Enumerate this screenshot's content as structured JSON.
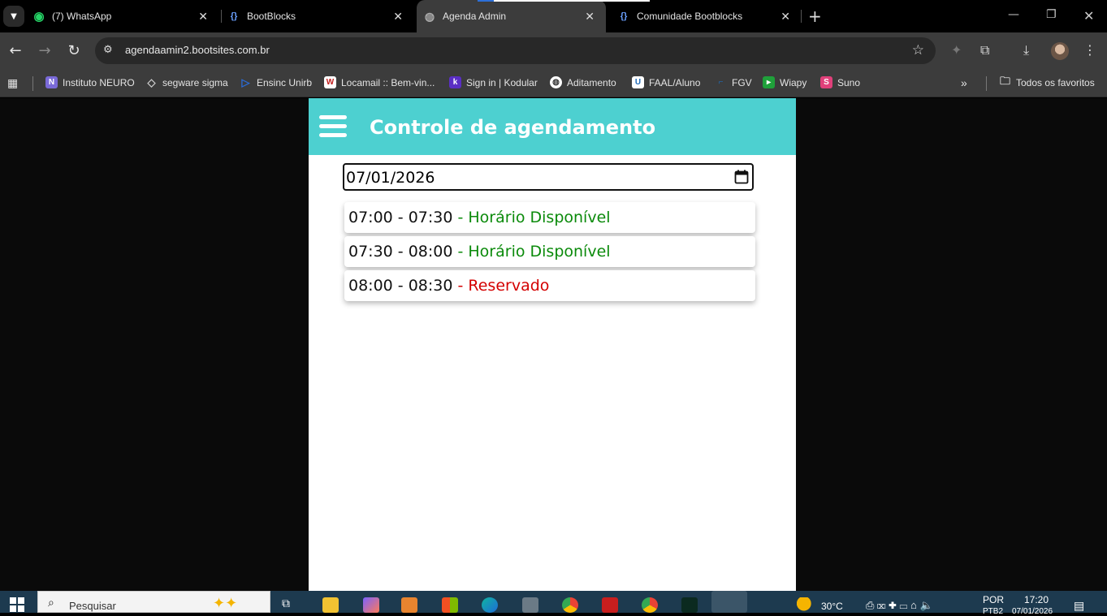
{
  "browser": {
    "tabs": [
      {
        "title": "(7) WhatsApp",
        "icon": "whatsapp-icon",
        "active": false
      },
      {
        "title": "BootBlocks",
        "icon": "bootblocks-icon",
        "active": false
      },
      {
        "title": "Agenda Admin",
        "icon": "globe-icon",
        "active": true
      },
      {
        "title": "Comunidade Bootblocks",
        "icon": "bootblocks-icon",
        "active": false
      }
    ],
    "url": "agendaamin2.bootsites.com.br",
    "bookmarks": [
      {
        "label": "Instituto NEURO",
        "icon": "neuro-icon",
        "color": "#7a6ad8"
      },
      {
        "label": "segware sigma",
        "icon": "sigma-icon",
        "color": "#555555"
      },
      {
        "label": "Ensinc Unirb",
        "icon": "play-icon",
        "color": "#2b6cd8"
      },
      {
        "label": "Locamail :: Bem-vin...",
        "icon": "locamail-icon",
        "color": "#c21d1d"
      },
      {
        "label": "Sign in | Kodular",
        "icon": "kodular-icon",
        "color": "#5a2ec4"
      },
      {
        "label": "Aditamento",
        "icon": "globe-icon",
        "color": "#dddddd"
      },
      {
        "label": "FAAL/Aluno",
        "icon": "faal-icon",
        "color": "#1e6bb8"
      },
      {
        "label": "FGV",
        "icon": "fgv-icon",
        "color": "#1e6bb8"
      },
      {
        "label": "Wiapy",
        "icon": "wiapy-icon",
        "color": "#1fa03a"
      },
      {
        "label": "Suno",
        "icon": "suno-icon",
        "color": "#e0407a"
      }
    ],
    "all_bookmarks_label": "Todos os favoritos"
  },
  "app": {
    "title": "Controle de agendamento",
    "header_color": "#4dd0d0",
    "date_value": "07/01/2026",
    "slots": [
      {
        "time": "07:00 - 07:30",
        "status": "- Horário Disponível",
        "state": "available"
      },
      {
        "time": "07:30 - 08:00",
        "status": "- Horário Disponível",
        "state": "available"
      },
      {
        "time": "08:00 - 08:30",
        "status": "- Reservado",
        "state": "reserved"
      }
    ],
    "available_color": "#0a8a0a",
    "reserved_color": "#d40000"
  },
  "taskbar": {
    "search_placeholder": "Pesquisar",
    "weather": "30°C",
    "language": "POR",
    "language_sub": "PTB2",
    "time": "17:20",
    "date": "07/01/2026"
  }
}
